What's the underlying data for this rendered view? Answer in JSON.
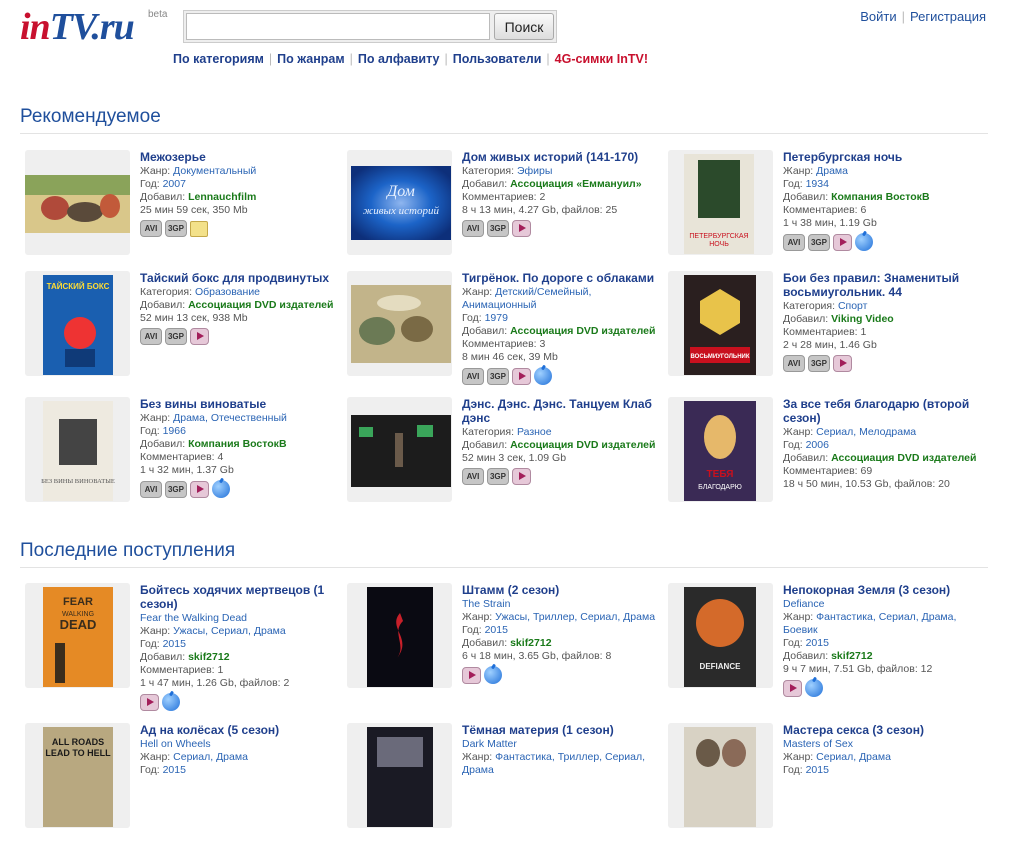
{
  "header": {
    "logo": {
      "in": "in",
      "tv": "TV",
      "ru": ".ru",
      "beta": "beta"
    },
    "search": {
      "value": "",
      "button": "Поиск"
    },
    "nav": [
      "По категориям",
      "По жанрам",
      "По алфавиту",
      "Пользователи"
    ],
    "nav_promo": "4G-симки InTV!",
    "login": "Войти",
    "register": "Регистрация"
  },
  "sections": {
    "recommended": {
      "title": "Рекомендуемое"
    },
    "latest": {
      "title": "Последние поступления"
    }
  },
  "recommended": [
    {
      "title": "Межозерье",
      "l1k": "Жанр:",
      "l1v": "Документальный",
      "l2k": "Год:",
      "l2v": "2007",
      "l3k": "Добавил:",
      "l3v": "Lennauchfilm",
      "l4": "25 мин 59 сек, 350 Mb",
      "l5": ""
    },
    {
      "title": "Дом живых историй (141-170)",
      "l1k": "Категория:",
      "l1v": "Эфиры",
      "l2k": "Добавил:",
      "l2v": "Ассоциация «Еммануил»",
      "l3k": "",
      "l3v": "",
      "l4": "Комментариев: 2",
      "l5": "8 ч 13 мин, 4.27 Gb, файлов: 25"
    },
    {
      "title": "Петербургская ночь",
      "l1k": "Жанр:",
      "l1v": "Драма",
      "l2k": "Год:",
      "l2v": "1934",
      "l3k": "Добавил:",
      "l3v": "Компания ВостокВ",
      "l4": "Комментариев: 6",
      "l5": "1 ч 38 мин, 1.19 Gb"
    },
    {
      "title": "Тайский бокс для продвинутых",
      "l1k": "Категория:",
      "l1v": "Образование",
      "l2k": "Добавил:",
      "l2v": "Ассоциация DVD издателей",
      "l3k": "",
      "l3v": "",
      "l4": "52 мин 13 сек, 938 Mb",
      "l5": ""
    },
    {
      "title": "Тигрёнок. По дороге с облаками",
      "l1k": "Жанр:",
      "l1v": "Детский/Семейный, Анимационный",
      "l2k": "Год:",
      "l2v": "1979",
      "l3k": "Добавил:",
      "l3v": "Ассоциация DVD издателей",
      "l4": "Комментариев: 3",
      "l5": "8 мин 46 сек, 39 Mb"
    },
    {
      "title": "Бои без правил: Знаменитый восьмиугольник. 44",
      "l1k": "Категория:",
      "l1v": "Спорт",
      "l2k": "Добавил:",
      "l2v": "Viking Video",
      "l3k": "",
      "l3v": "",
      "l4": "Комментариев: 1",
      "l5": "2 ч 28 мин, 1.46 Gb"
    },
    {
      "title": "Без вины виноватые",
      "l1k": "Жанр:",
      "l1v": "Драма, Отечественный",
      "l2k": "Год:",
      "l2v": "1966",
      "l3k": "Добавил:",
      "l3v": "Компания ВостокВ",
      "l4": "Комментариев: 4",
      "l5": "1 ч 32 мин, 1.37 Gb"
    },
    {
      "title": "Дэнс. Дэнс. Дэнс. Танцуем Клаб дэнс",
      "l1k": "Категория:",
      "l1v": "Разное",
      "l2k": "Добавил:",
      "l2v": "Ассоциация DVD издателей",
      "l3k": "",
      "l3v": "",
      "l4": "52 мин 3 сек, 1.09 Gb",
      "l5": ""
    },
    {
      "title": "За все тебя благодарю (второй сезон)",
      "l1k": "Жанр:",
      "l1v": "Сериал, Мелодрама",
      "l2k": "Год:",
      "l2v": "2006",
      "l3k": "Добавил:",
      "l3v": "Ассоциация DVD издателей",
      "l4": "Комментариев: 69",
      "l5": "18 ч 50 мин, 10.53 Gb, файлов: 20"
    }
  ],
  "latest": [
    {
      "title": "Бойтесь ходячих мертвецов (1 сезон)",
      "orig": "Fear the Walking Dead",
      "l1k": "Жанр:",
      "l1v": "Ужасы, Сериал, Драма",
      "l2k": "Год:",
      "l2v": "2015",
      "l3k": "Добавил:",
      "l3v": "skif2712",
      "l4": "Комментариев: 1",
      "l5": "1 ч 47 мин, 1.26 Gb, файлов: 2"
    },
    {
      "title": "Штамм (2 сезон)",
      "orig": "The Strain",
      "l1k": "Жанр:",
      "l1v": "Ужасы, Триллер, Сериал, Драма",
      "l2k": "Год:",
      "l2v": "2015",
      "l3k": "Добавил:",
      "l3v": "skif2712",
      "l4": "6 ч 18 мин, 3.65 Gb, файлов: 8",
      "l5": ""
    },
    {
      "title": "Непокорная Земля (3 сезон)",
      "orig": "Defiance",
      "l1k": "Жанр:",
      "l1v": "Фантастика, Сериал, Драма, Боевик",
      "l2k": "Год:",
      "l2v": "2015",
      "l3k": "Добавил:",
      "l3v": "skif2712",
      "l4": "9 ч 7 мин, 7.51 Gb, файлов: 12",
      "l5": ""
    },
    {
      "title": "Ад на колёсах (5 сезон)",
      "orig": "Hell on Wheels",
      "l1k": "Жанр:",
      "l1v": "Сериал, Драма",
      "l2k": "Год:",
      "l2v": "2015",
      "l3k": "",
      "l3v": "",
      "l4": "",
      "l5": ""
    },
    {
      "title": "Тёмная материя (1 сезон)",
      "orig": "Dark Matter",
      "l1k": "Жанр:",
      "l1v": "Фантастика, Триллер, Сериал, Драма",
      "l2k": "",
      "l2v": "",
      "l3k": "",
      "l3v": "",
      "l4": "",
      "l5": ""
    },
    {
      "title": "Мастера секса (3 сезон)",
      "orig": "Masters of Sex",
      "l1k": "Жанр:",
      "l1v": "Сериал, Драма",
      "l2k": "Год:",
      "l2v": "2015",
      "l3k": "",
      "l3v": "",
      "l4": "",
      "l5": ""
    }
  ],
  "thumbs": {
    "t1": {
      "colors": [
        "#8aa35a",
        "#d9c78a",
        "#b04a3a"
      ]
    },
    "t2": {
      "colors": [
        "#0d2f7a",
        "#1c64c8",
        "#8fb6ef"
      ],
      "text1": "Дом",
      "text2": "живых историй"
    },
    "t3": {
      "colors": [
        "#e8e4d8",
        "#2b4a2b"
      ],
      "text": "ПЕТЕРБУРГСКАЯ НОЧЬ"
    },
    "t4": {
      "colors": [
        "#1a5fb0",
        "#e33",
        "#ffdd33"
      ],
      "text": "ТАЙСКИЙ БОКС"
    },
    "t5": {
      "colors": [
        "#c2b48a",
        "#6b7a55"
      ]
    },
    "t6": {
      "colors": [
        "#2a1f1f",
        "#c8101e",
        "#e8c34a"
      ],
      "text": "ВОСЬМИУГОЛЬНИК"
    },
    "t7": {
      "colors": [
        "#eeeae0",
        "#444"
      ],
      "text": "БЕЗ ВИНЫ ВИНОВАТЫЕ"
    },
    "t8": {
      "colors": [
        "#1c1c1c",
        "#3aa55a"
      ]
    },
    "t9": {
      "colors": [
        "#3a2a55",
        "#e6b86a",
        "#c8101e"
      ],
      "text": "ЗА ВСЕ ТЕБЯ БЛАГОДАРЮ"
    },
    "t10": {
      "colors": [
        "#e58a25",
        "#3a2d1c"
      ],
      "text1": "FEAR",
      "text2": "WALKING",
      "text3": "DEAD"
    },
    "t11": {
      "colors": [
        "#0a0a12",
        "#c8202a"
      ]
    },
    "t12": {
      "colors": [
        "#2a2a2a",
        "#d46a2a"
      ],
      "text": "DEFIANCE"
    },
    "t13": {
      "colors": [
        "#b8a880",
        "#3a3a3a"
      ],
      "text1": "ALL ROADS",
      "text2": "LEAD TO HELL"
    },
    "t14": {
      "colors": [
        "#1a1a24",
        "#6a6a7a"
      ]
    },
    "t15": {
      "colors": [
        "#d8d2c4",
        "#6a5a48"
      ]
    }
  }
}
